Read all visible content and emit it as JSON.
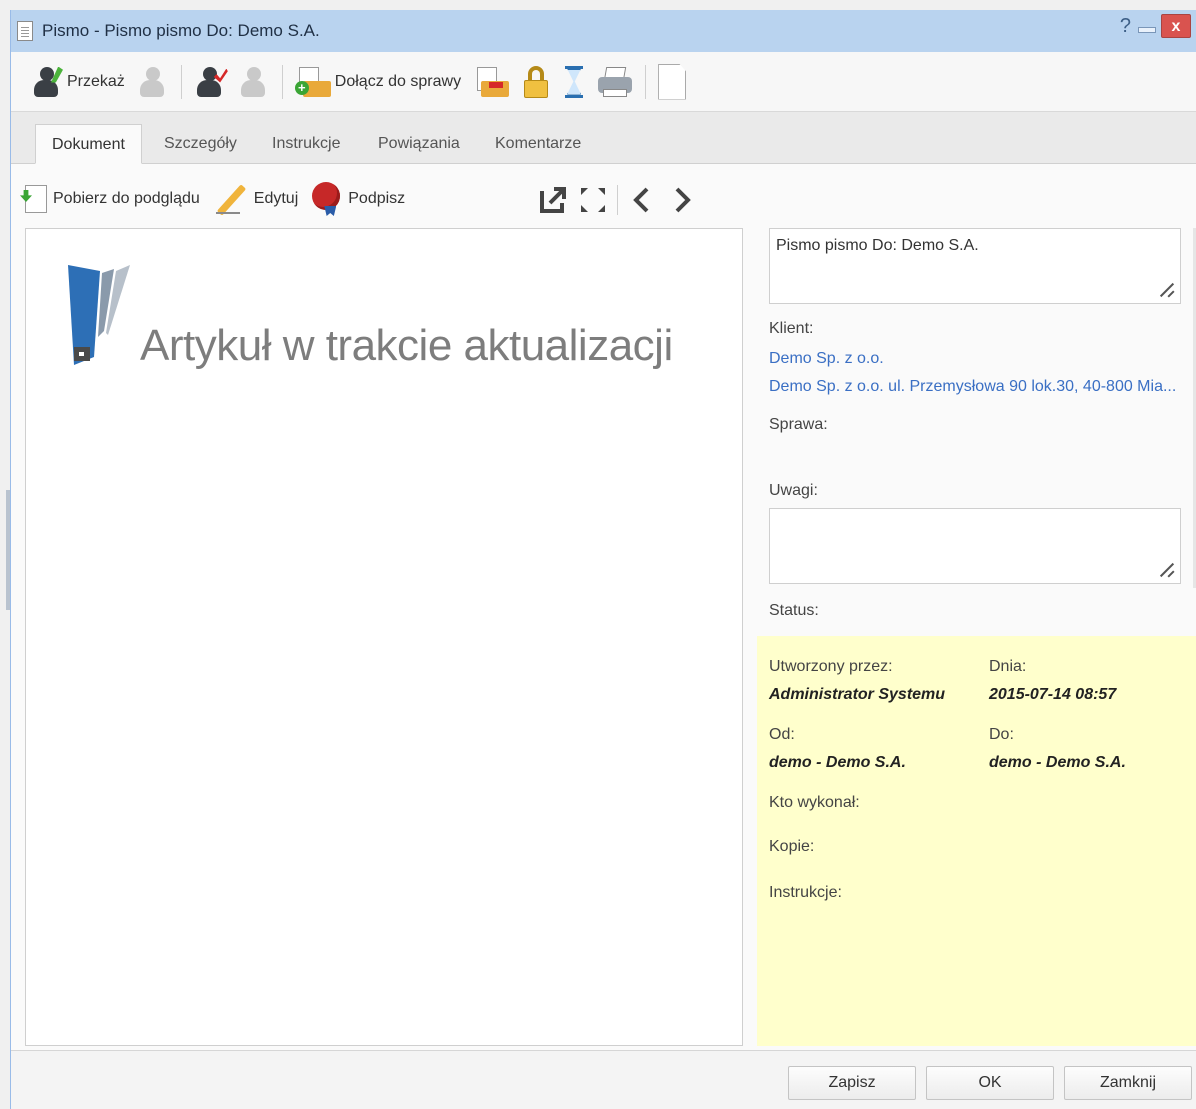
{
  "window": {
    "title": "Pismo - Pismo pismo Do: Demo S.A.",
    "help_glyph": "?",
    "close_glyph": "x"
  },
  "toolbar": {
    "forward_label": "Przekaż",
    "attach_label": "Dołącz do sprawy",
    "icons": [
      "forward-user-icon",
      "forward-user-disabled-icon",
      "accept-user-icon",
      "accept-user-disabled-icon",
      "attach-to-case-icon",
      "remove-from-case-icon",
      "lock-icon",
      "hourglass-icon",
      "print-icon",
      "blank-document-icon"
    ]
  },
  "tabs": [
    {
      "label": "Dokument",
      "active": true
    },
    {
      "label": "Szczegóły"
    },
    {
      "label": "Instrukcje"
    },
    {
      "label": "Powiązania"
    },
    {
      "label": "Komentarze"
    }
  ],
  "doc_toolbar": {
    "download_label": "Pobierz do podglądu",
    "edit_label": "Edytuj",
    "sign_label": "Podpisz"
  },
  "preview": {
    "message": "Artykuł w trakcie aktualizacji"
  },
  "side": {
    "title_value": "Pismo pismo Do: Demo S.A.",
    "client_label": "Klient:",
    "client_name": "Demo Sp. z o.o.",
    "client_address": "Demo Sp. z o.o. ul. Przemysłowa 90 lok.30, 40-800 Mia...",
    "case_label": "Sprawa:",
    "notes_label": "Uwagi:",
    "notes_value": "",
    "status_label": "Status:"
  },
  "info": {
    "created_by_label": "Utworzony przez:",
    "created_by_value": "Administrator Systemu",
    "date_label": "Dnia:",
    "date_value": "2015-07-14 08:57",
    "from_label": "Od:",
    "from_value": "demo - Demo S.A.",
    "to_label": "Do:",
    "to_value": "demo - Demo S.A.",
    "executed_by_label": "Kto wykonał:",
    "copies_label": "Kopie:",
    "instructions_label": "Instrukcje:",
    "background_color": "#ffffcc"
  },
  "footer": {
    "save_label": "Zapisz",
    "ok_label": "OK",
    "close_label": "Zamknij"
  },
  "colors": {
    "titlebar": "#b9d3ef",
    "link": "#3a6fc4",
    "close_button": "#d9534f"
  }
}
